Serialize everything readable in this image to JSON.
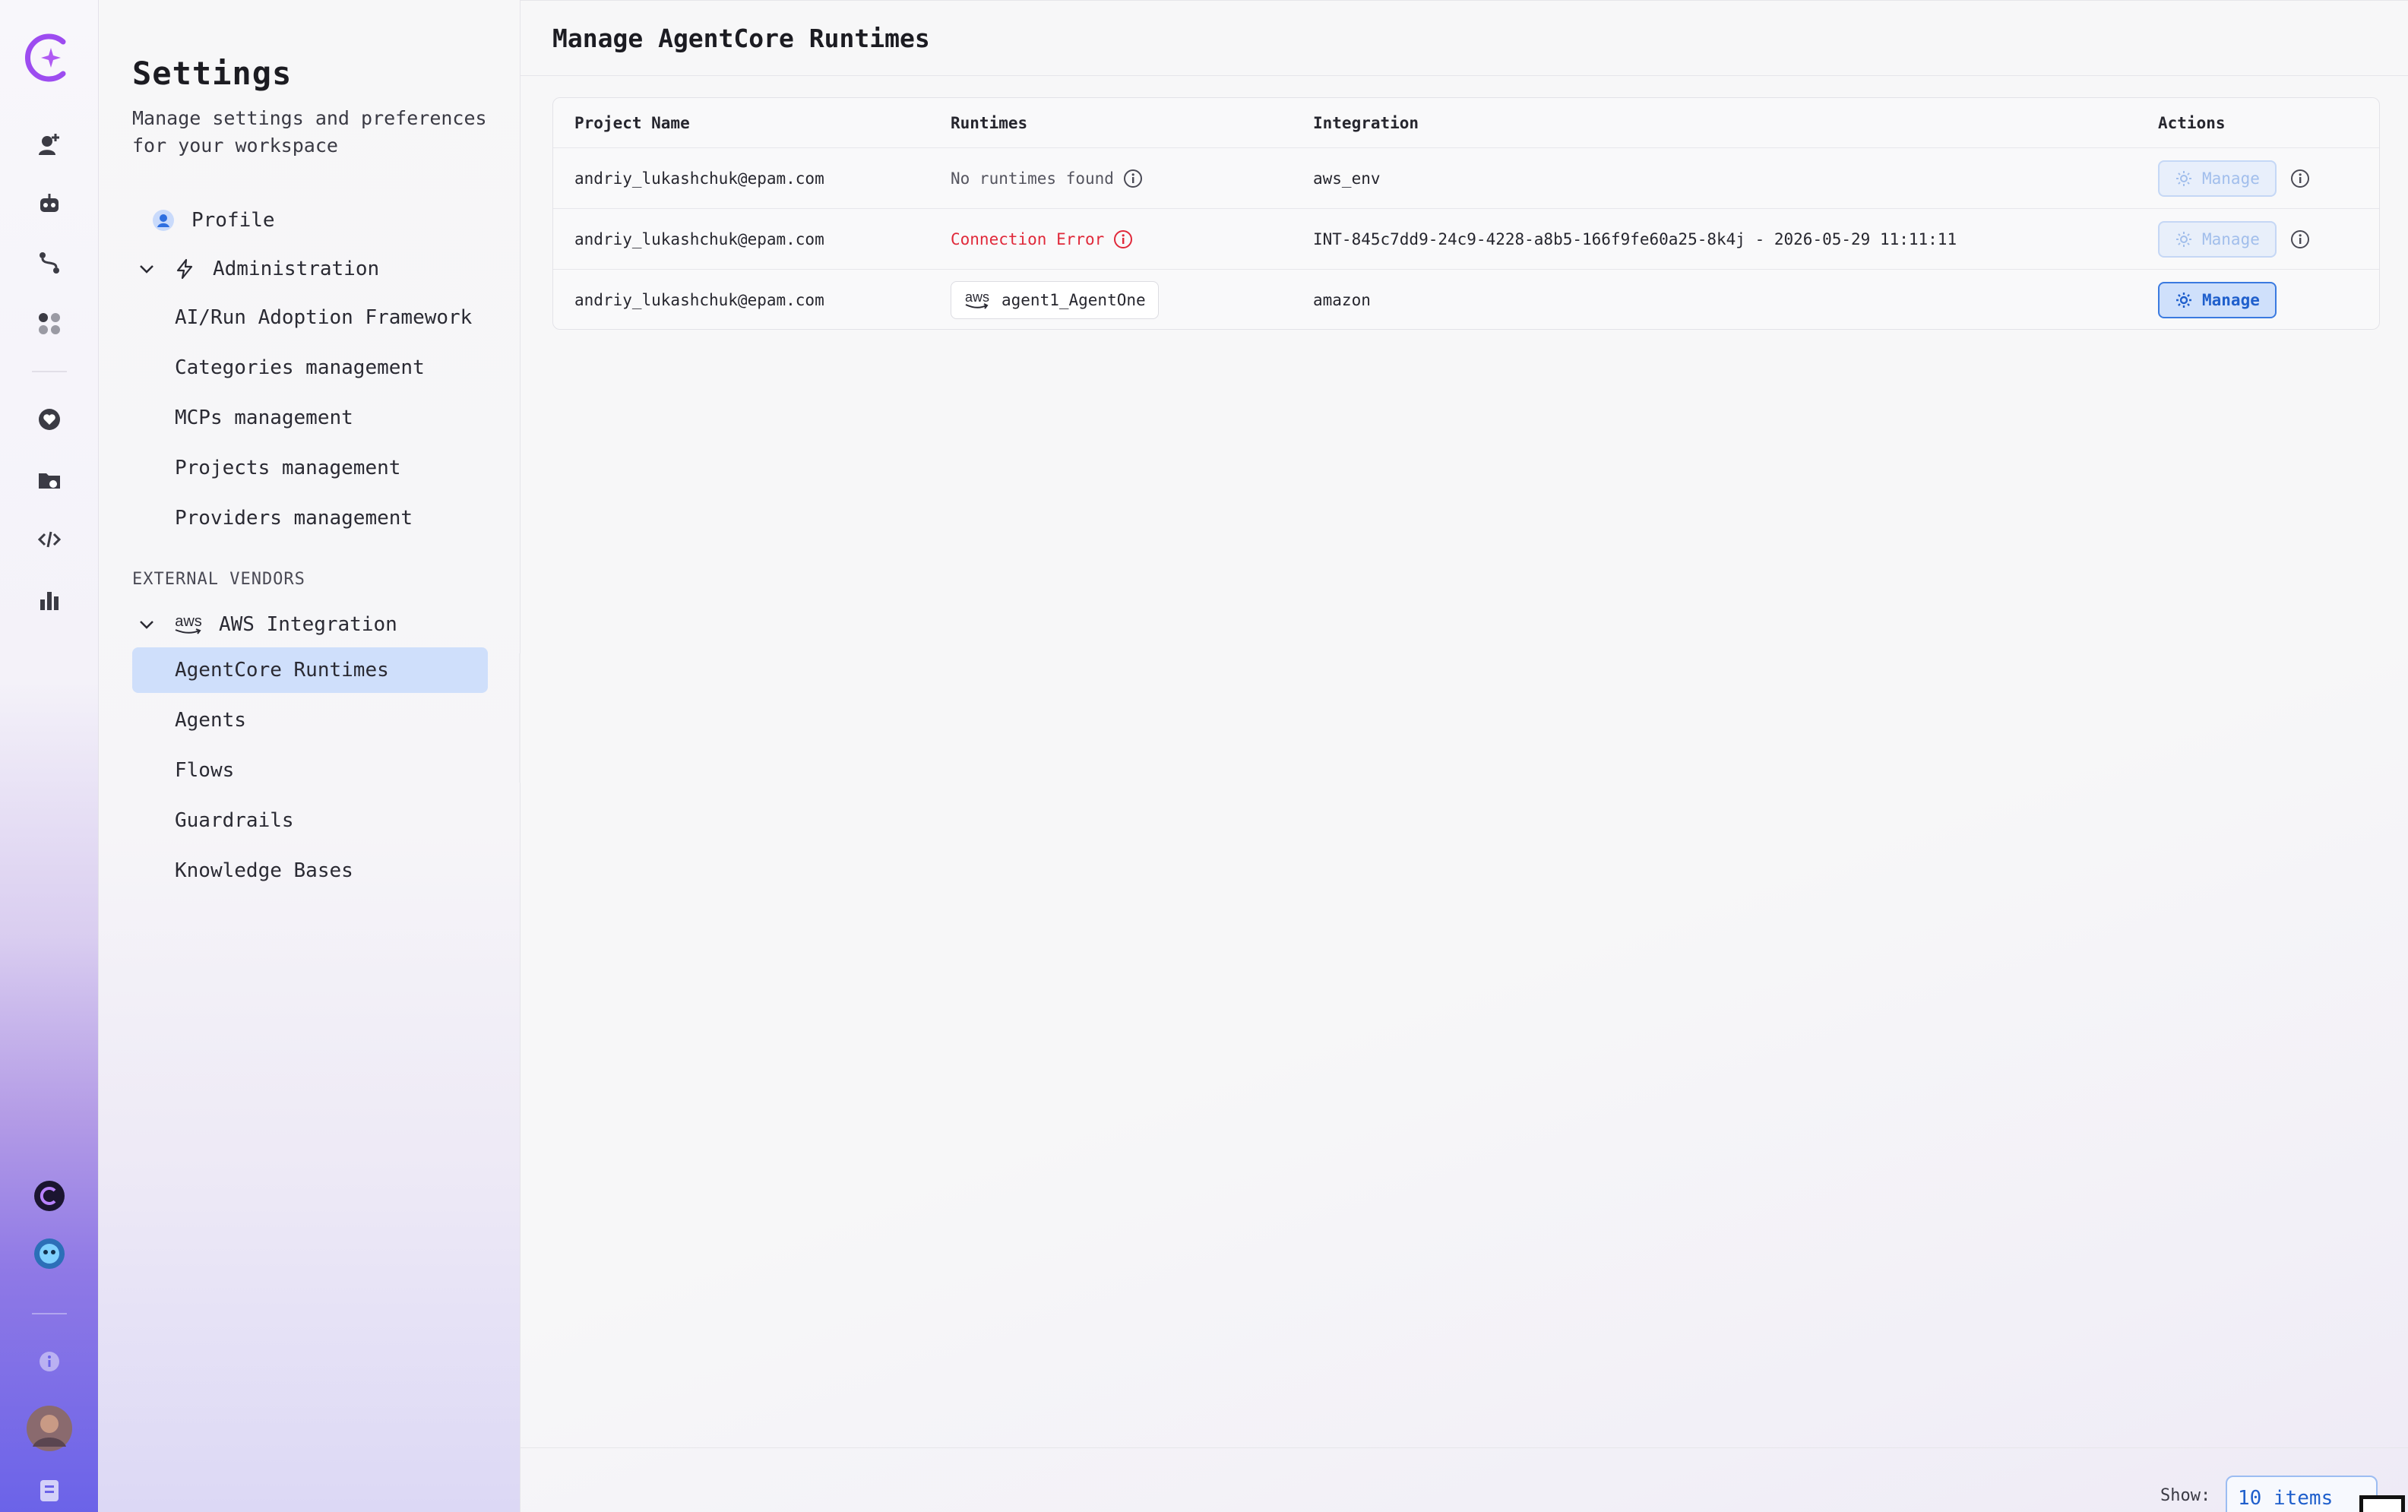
{
  "rail": {
    "icons": [
      "app-logo-icon",
      "new-assistant-icon",
      "robot-icon",
      "workflow-icon",
      "apps-icon",
      "heart-icon",
      "folder-icon",
      "code-icon",
      "analytics-icon",
      "brand-icon",
      "mascot-icon",
      "info-icon",
      "user-avatar",
      "docs-icon"
    ]
  },
  "panel": {
    "title": "Settings",
    "subtitle": "Manage settings and preferences for your workspace",
    "profile": "Profile",
    "administration": "Administration",
    "admin_items": [
      "AI/Run Adoption Framework",
      "Categories management",
      "MCPs management",
      "Projects management",
      "Providers management"
    ],
    "external_vendors": "EXTERNAL VENDORS",
    "aws_integration": "AWS Integration",
    "aws_logo_text": "aws",
    "aws_items": [
      "AgentCore Runtimes",
      "Agents",
      "Flows",
      "Guardrails",
      "Knowledge Bases"
    ],
    "collapse_glyph": "❮"
  },
  "main": {
    "title": "Manage AgentCore Runtimes",
    "columns": [
      "Project Name",
      "Runtimes",
      "Integration",
      "Actions"
    ],
    "rows": [
      {
        "project": "andriy_lukashchuk@epam.com",
        "runtime": "No runtimes found",
        "runtime_status": "empty",
        "integration": "aws_env",
        "action": "Manage",
        "action_enabled": false
      },
      {
        "project": "andriy_lukashchuk@epam.com",
        "runtime": "Connection Error",
        "runtime_status": "error",
        "integration": "INT-845c7dd9-24c9-4228-a8b5-166f9fe60a25-8k4j - 2026-05-29 11:11:11",
        "action": "Manage",
        "action_enabled": false
      },
      {
        "project": "andriy_lukashchuk@epam.com",
        "runtime": "agent1_AgentOne",
        "runtime_status": "ok",
        "runtime_logo": "aws",
        "integration": "amazon",
        "action": "Manage",
        "action_enabled": true
      }
    ]
  },
  "footer": {
    "show_label": "Show:",
    "page_size": "10 items"
  },
  "colors": {
    "accent": "#1f5fcc",
    "active_nav": "#cfdffb",
    "error": "#e0293a",
    "brand_purple": "#8b3dff"
  }
}
